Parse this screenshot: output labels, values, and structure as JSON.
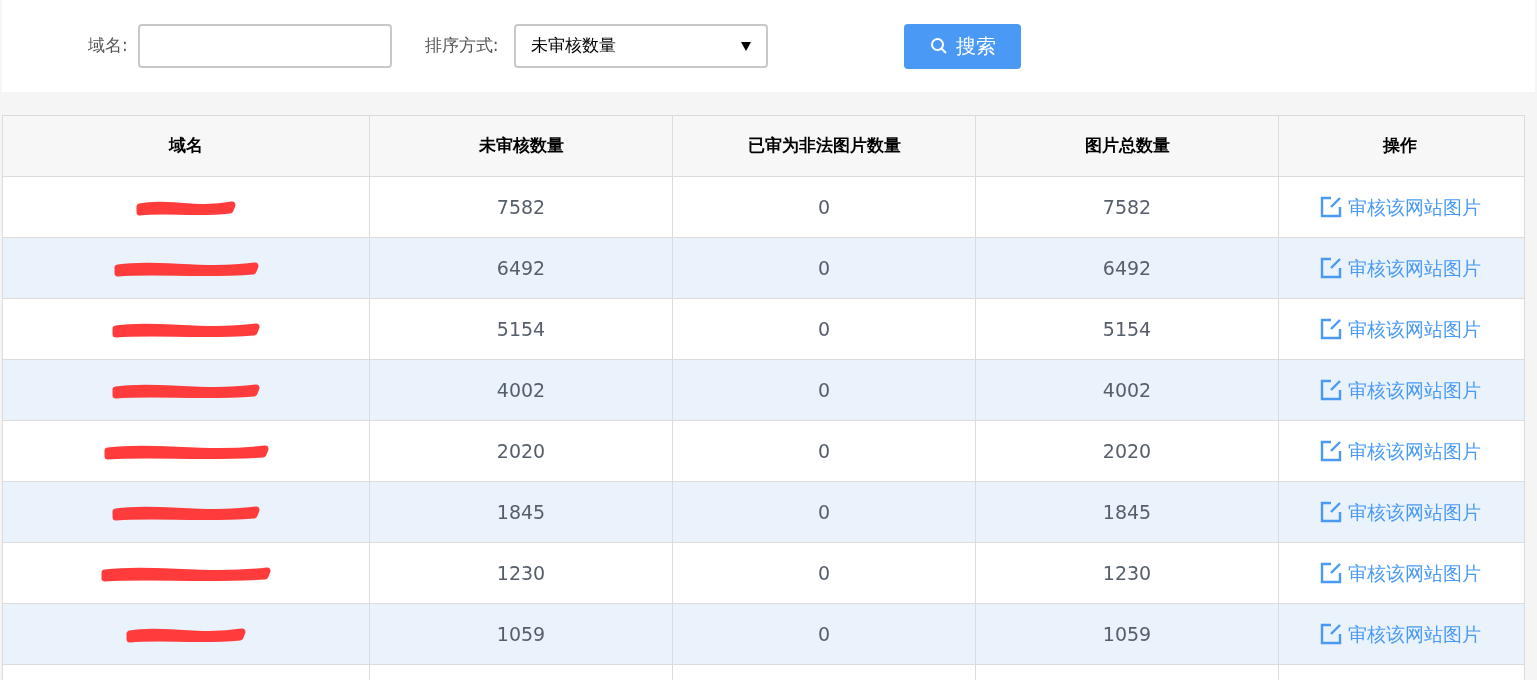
{
  "filters": {
    "domain": {
      "label": "域名:"
    },
    "sort": {
      "label": "排序方式:",
      "value": "未审核数量"
    },
    "search_button": "搜索"
  },
  "table": {
    "columns": [
      "域名",
      "未审核数量",
      "已审为非法图片数量",
      "图片总数量",
      "操作"
    ],
    "rows": [
      {
        "redacted": true,
        "pending": "7582",
        "illegal": "0",
        "total": "7582",
        "action": "审核该网站图片"
      },
      {
        "redacted": true,
        "pending": "6492",
        "illegal": "0",
        "total": "6492",
        "action": "审核该网站图片"
      },
      {
        "redacted": true,
        "pending": "5154",
        "illegal": "0",
        "total": "5154",
        "action": "审核该网站图片"
      },
      {
        "redacted": true,
        "pending": "4002",
        "illegal": "0",
        "total": "4002",
        "action": "审核该网站图片"
      },
      {
        "redacted": true,
        "pending": "2020",
        "illegal": "0",
        "total": "2020",
        "action": "审核该网站图片"
      },
      {
        "redacted": true,
        "pending": "1845",
        "illegal": "0",
        "total": "1845",
        "action": "审核该网站图片"
      },
      {
        "redacted": true,
        "pending": "1230",
        "illegal": "0",
        "total": "1230",
        "action": "审核该网站图片"
      },
      {
        "redacted": true,
        "pending": "1059",
        "illegal": "0",
        "total": "1059",
        "action": "审核该网站图片"
      }
    ]
  }
}
